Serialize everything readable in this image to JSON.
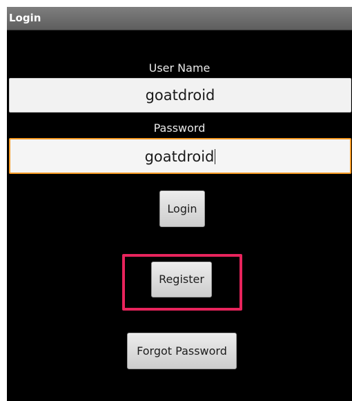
{
  "window": {
    "title": "Login"
  },
  "form": {
    "username_label": "User Name",
    "username_value": "goatdroid",
    "password_label": "Password",
    "password_value": "goatdroid"
  },
  "buttons": {
    "login_label": "Login",
    "register_label": "Register",
    "forgot_password_label": "Forgot Password"
  },
  "annotation": {
    "highlight_color": "#e8245c",
    "highlighted_element": "register-button"
  },
  "colors": {
    "titlebar": "#6e6e6e",
    "background": "#000000",
    "focus_border": "#f59a23"
  }
}
